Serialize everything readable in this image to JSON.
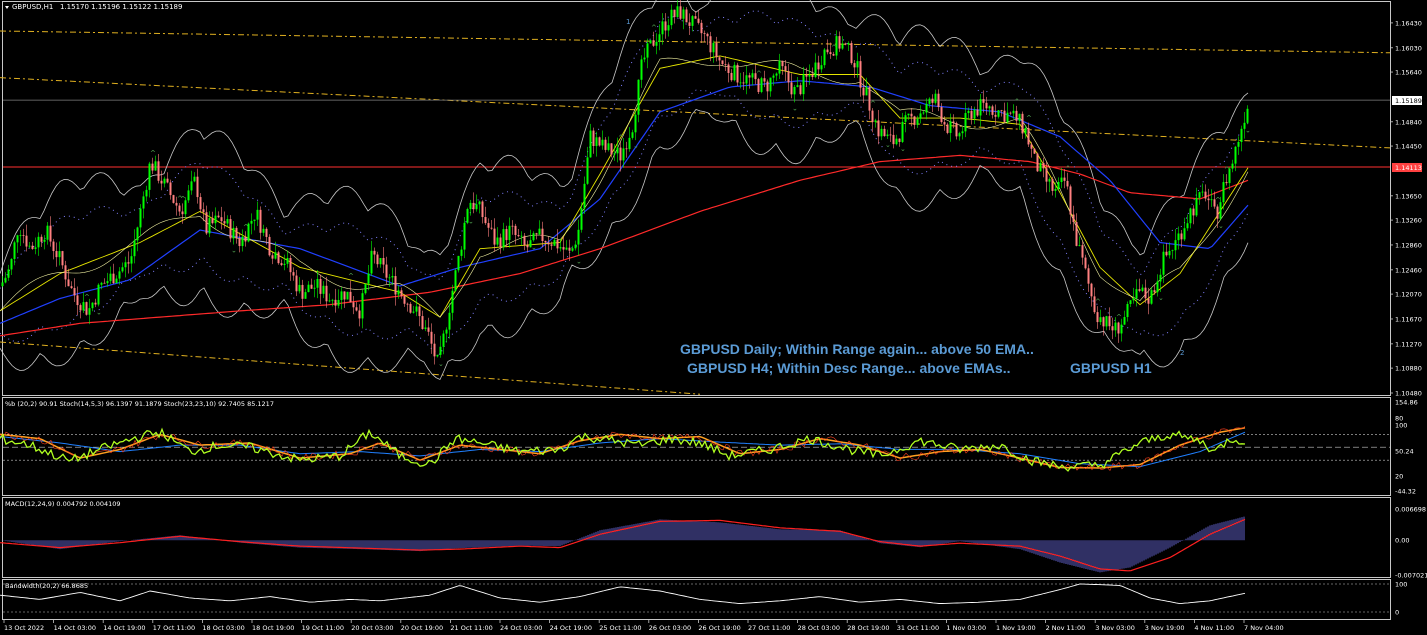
{
  "window": {
    "title": "GBPUSD,H1",
    "ohlc": "1.15170 1.15196 1.15122 1.15189"
  },
  "colors": {
    "background": "#000000",
    "frame": "#c8c8c8",
    "bull": "#00ff00",
    "bear": "#ff8080",
    "ema_red": "#ff2a2a",
    "ema_blue": "#2040ff",
    "ema_yellow": "#e6e600",
    "bands": "#c8c8c8",
    "channel": "#e0b020",
    "annotation": "#5b9bd5",
    "pct_b": "#b0ff20",
    "stoch_slow": "#ffa020",
    "stoch_mid": "#2080ff",
    "macd_hist": "#6060c8",
    "macd_signal": "#ff2020",
    "bandwidth": "#ffffff"
  },
  "main_panel": {
    "price_ticks": [
      "1.16430",
      "1.16030",
      "1.15640",
      "1.14840",
      "1.14450",
      "1.13650",
      "1.13260",
      "1.12860",
      "1.12460",
      "1.12070",
      "1.11670",
      "1.11270",
      "1.10880",
      "1.10480"
    ],
    "current_price_label": "1.15189",
    "level_price_label": "1.14113",
    "wave_labels": [
      "1",
      "2"
    ],
    "annotations": [
      "GBPUSD Daily; Within Range again... above 50 EMA..",
      "GBPUSD H4;  Within Desc Range... above EMAs..",
      "GBPUSD H1"
    ]
  },
  "indicator_panel": {
    "title": "%b (20,2) 90.91  Stoch(14,5,3) 96.1397 91.1879  Stoch(23,23,10) 92.7405 85.1217",
    "ticks": [
      "154.86",
      "80",
      "100",
      "50.24",
      "20",
      "-44.32"
    ]
  },
  "macd_panel": {
    "title": "MACD(12,24,9) 0.004792 0.004109",
    "ticks": [
      "0.006698",
      "0.00",
      "-0.007021"
    ]
  },
  "bandwidth_panel": {
    "title": "Bandwidth(20,2) 66.8685",
    "ticks": [
      "100",
      "0"
    ]
  },
  "time_axis": {
    "labels": [
      "13 Oct 2022",
      "14 Oct 03:00",
      "14 Oct 19:00",
      "17 Oct 11:00",
      "18 Oct 03:00",
      "18 Oct 19:00",
      "19 Oct 11:00",
      "20 Oct 03:00",
      "20 Oct 19:00",
      "21 Oct 11:00",
      "24 Oct 03:00",
      "24 Oct 19:00",
      "25 Oct 11:00",
      "26 Oct 03:00",
      "26 Oct 19:00",
      "27 Oct 11:00",
      "28 Oct 03:00",
      "28 Oct 19:00",
      "31 Oct 11:00",
      "1 Nov 03:00",
      "1 Nov 19:00",
      "2 Nov 11:00",
      "3 Nov 03:00",
      "3 Nov 19:00",
      "4 Nov 11:00",
      "7 Nov 04:00"
    ]
  },
  "chart_data": {
    "type": "candlestick",
    "symbol": "GBPUSD",
    "timeframe": "H1",
    "ylim": [
      1.1048,
      1.1675
    ],
    "close_path": [
      [
        0,
        1.122
      ],
      [
        10,
        1.125
      ],
      [
        18,
        1.132
      ],
      [
        30,
        1.128
      ],
      [
        45,
        1.131
      ],
      [
        60,
        1.126
      ],
      [
        72,
        1.121
      ],
      [
        88,
        1.118
      ],
      [
        100,
        1.122
      ],
      [
        115,
        1.124
      ],
      [
        130,
        1.126
      ],
      [
        150,
        1.142
      ],
      [
        165,
        1.138
      ],
      [
        180,
        1.134
      ],
      [
        195,
        1.139
      ],
      [
        205,
        1.131
      ],
      [
        220,
        1.133
      ],
      [
        240,
        1.129
      ],
      [
        255,
        1.134
      ],
      [
        270,
        1.128
      ],
      [
        285,
        1.126
      ],
      [
        300,
        1.121
      ],
      [
        315,
        1.122
      ],
      [
        330,
        1.12
      ],
      [
        345,
        1.121
      ],
      [
        360,
        1.118
      ],
      [
        372,
        1.127
      ],
      [
        385,
        1.124
      ],
      [
        400,
        1.121
      ],
      [
        415,
        1.118
      ],
      [
        428,
        1.114
      ],
      [
        438,
        1.109
      ],
      [
        448,
        1.118
      ],
      [
        460,
        1.128
      ],
      [
        468,
        1.136
      ],
      [
        480,
        1.134
      ],
      [
        495,
        1.129
      ],
      [
        510,
        1.131
      ],
      [
        525,
        1.128
      ],
      [
        540,
        1.13
      ],
      [
        555,
        1.129
      ],
      [
        570,
        1.127
      ],
      [
        578,
        1.131
      ],
      [
        590,
        1.146
      ],
      [
        605,
        1.144
      ],
      [
        620,
        1.143
      ],
      [
        632,
        1.148
      ],
      [
        642,
        1.158
      ],
      [
        655,
        1.162
      ],
      [
        668,
        1.165
      ],
      [
        680,
        1.166
      ],
      [
        692,
        1.164
      ],
      [
        705,
        1.162
      ],
      [
        720,
        1.158
      ],
      [
        735,
        1.156
      ],
      [
        750,
        1.155
      ],
      [
        765,
        1.154
      ],
      [
        780,
        1.157
      ],
      [
        795,
        1.153
      ],
      [
        810,
        1.156
      ],
      [
        825,
        1.16
      ],
      [
        840,
        1.161
      ],
      [
        852,
        1.159
      ],
      [
        865,
        1.153
      ],
      [
        878,
        1.147
      ],
      [
        892,
        1.145
      ],
      [
        905,
        1.148
      ],
      [
        920,
        1.15
      ],
      [
        935,
        1.152
      ],
      [
        945,
        1.148
      ],
      [
        958,
        1.146
      ],
      [
        970,
        1.15
      ],
      [
        985,
        1.151
      ],
      [
        1000,
        1.15
      ],
      [
        1015,
        1.149
      ],
      [
        1025,
        1.147
      ],
      [
        1034,
        1.142
      ],
      [
        1045,
        1.139
      ],
      [
        1055,
        1.137
      ],
      [
        1065,
        1.139
      ],
      [
        1075,
        1.13
      ],
      [
        1085,
        1.124
      ],
      [
        1095,
        1.118
      ],
      [
        1105,
        1.116
      ],
      [
        1115,
        1.115
      ],
      [
        1125,
        1.117
      ],
      [
        1138,
        1.121
      ],
      [
        1150,
        1.12
      ],
      [
        1162,
        1.126
      ],
      [
        1175,
        1.129
      ],
      [
        1190,
        1.134
      ],
      [
        1205,
        1.137
      ],
      [
        1215,
        1.133
      ],
      [
        1225,
        1.139
      ],
      [
        1232,
        1.142
      ],
      [
        1240,
        1.147
      ],
      [
        1248,
        1.1519
      ]
    ],
    "ema_red_path": [
      [
        0,
        1.114
      ],
      [
        80,
        1.116
      ],
      [
        160,
        1.117
      ],
      [
        240,
        1.118
      ],
      [
        330,
        1.119
      ],
      [
        430,
        1.121
      ],
      [
        520,
        1.124
      ],
      [
        600,
        1.128
      ],
      [
        700,
        1.134
      ],
      [
        800,
        1.139
      ],
      [
        880,
        1.142
      ],
      [
        960,
        1.143
      ],
      [
        1030,
        1.142
      ],
      [
        1080,
        1.14
      ],
      [
        1130,
        1.137
      ],
      [
        1200,
        1.136
      ],
      [
        1248,
        1.139
      ]
    ],
    "ema_blue_path": [
      [
        0,
        1.116
      ],
      [
        60,
        1.12
      ],
      [
        130,
        1.123
      ],
      [
        200,
        1.131
      ],
      [
        300,
        1.128
      ],
      [
        400,
        1.122
      ],
      [
        460,
        1.125
      ],
      [
        540,
        1.128
      ],
      [
        600,
        1.136
      ],
      [
        660,
        1.15
      ],
      [
        730,
        1.154
      ],
      [
        800,
        1.155
      ],
      [
        870,
        1.154
      ],
      [
        930,
        1.151
      ],
      [
        1000,
        1.15
      ],
      [
        1060,
        1.146
      ],
      [
        1110,
        1.139
      ],
      [
        1160,
        1.129
      ],
      [
        1210,
        1.128
      ],
      [
        1248,
        1.135
      ]
    ],
    "ema_yellow_path": [
      [
        0,
        1.118
      ],
      [
        60,
        1.124
      ],
      [
        140,
        1.129
      ],
      [
        200,
        1.134
      ],
      [
        300,
        1.125
      ],
      [
        400,
        1.121
      ],
      [
        440,
        1.117
      ],
      [
        480,
        1.128
      ],
      [
        560,
        1.129
      ],
      [
        600,
        1.14
      ],
      [
        660,
        1.157
      ],
      [
        720,
        1.159
      ],
      [
        800,
        1.156
      ],
      [
        860,
        1.156
      ],
      [
        900,
        1.149
      ],
      [
        960,
        1.149
      ],
      [
        1020,
        1.148
      ],
      [
        1060,
        1.137
      ],
      [
        1100,
        1.125
      ],
      [
        1140,
        1.119
      ],
      [
        1180,
        1.124
      ],
      [
        1220,
        1.134
      ],
      [
        1248,
        1.141
      ]
    ],
    "channel_lines": [
      {
        "from": [
          0,
          1.163
        ],
        "to": [
          1390,
          1.1595
        ]
      },
      {
        "from": [
          0,
          1.1555
        ],
        "to": [
          1390,
          1.1442
        ]
      },
      {
        "from": [
          0,
          1.113
        ],
        "to": [
          700,
          1.1046
        ]
      }
    ],
    "horizontal_levels": [
      1.15189,
      1.14113
    ],
    "indicator_series": {
      "pct_b": [
        [
          0,
          70
        ],
        [
          30,
          55
        ],
        [
          70,
          18
        ],
        [
          100,
          45
        ],
        [
          140,
          75
        ],
        [
          160,
          85
        ],
        [
          190,
          40
        ],
        [
          220,
          55
        ],
        [
          250,
          50
        ],
        [
          300,
          20
        ],
        [
          340,
          30
        ],
        [
          370,
          85
        ],
        [
          400,
          30
        ],
        [
          430,
          10
        ],
        [
          455,
          70
        ],
        [
          480,
          60
        ],
        [
          520,
          40
        ],
        [
          560,
          45
        ],
        [
          580,
          75
        ],
        [
          600,
          70
        ],
        [
          640,
          55
        ],
        [
          670,
          70
        ],
        [
          700,
          60
        ],
        [
          730,
          30
        ],
        [
          770,
          45
        ],
        [
          810,
          70
        ],
        [
          850,
          45
        ],
        [
          880,
          30
        ],
        [
          920,
          65
        ],
        [
          960,
          45
        ],
        [
          1000,
          55
        ],
        [
          1030,
          20
        ],
        [
          1060,
          5
        ],
        [
          1100,
          8
        ],
        [
          1140,
          60
        ],
        [
          1170,
          80
        ],
        [
          1200,
          65
        ],
        [
          1215,
          40
        ],
        [
          1230,
          70
        ],
        [
          1245,
          65
        ]
      ],
      "stoch_slow": [
        [
          0,
          80
        ],
        [
          40,
          70
        ],
        [
          80,
          25
        ],
        [
          120,
          45
        ],
        [
          160,
          80
        ],
        [
          200,
          55
        ],
        [
          250,
          60
        ],
        [
          300,
          25
        ],
        [
          350,
          35
        ],
        [
          380,
          60
        ],
        [
          420,
          20
        ],
        [
          460,
          55
        ],
        [
          500,
          45
        ],
        [
          540,
          35
        ],
        [
          580,
          65
        ],
        [
          620,
          80
        ],
        [
          660,
          70
        ],
        [
          700,
          75
        ],
        [
          740,
          35
        ],
        [
          780,
          45
        ],
        [
          820,
          70
        ],
        [
          860,
          55
        ],
        [
          900,
          25
        ],
        [
          940,
          40
        ],
        [
          980,
          45
        ],
        [
          1020,
          25
        ],
        [
          1060,
          3
        ],
        [
          1100,
          2
        ],
        [
          1140,
          10
        ],
        [
          1180,
          55
        ],
        [
          1220,
          85
        ],
        [
          1245,
          95
        ]
      ],
      "stoch_mid": [
        [
          0,
          75
        ],
        [
          60,
          60
        ],
        [
          120,
          40
        ],
        [
          180,
          55
        ],
        [
          240,
          55
        ],
        [
          300,
          35
        ],
        [
          360,
          40
        ],
        [
          420,
          30
        ],
        [
          480,
          45
        ],
        [
          540,
          40
        ],
        [
          600,
          60
        ],
        [
          660,
          70
        ],
        [
          720,
          62
        ],
        [
          780,
          55
        ],
        [
          840,
          58
        ],
        [
          900,
          45
        ],
        [
          960,
          45
        ],
        [
          1020,
          35
        ],
        [
          1080,
          12
        ],
        [
          1140,
          5
        ],
        [
          1200,
          40
        ],
        [
          1245,
          85
        ]
      ]
    },
    "macd_series": {
      "signal": [
        [
          0,
          -0.0005
        ],
        [
          60,
          -0.0015
        ],
        [
          120,
          -0.0005
        ],
        [
          180,
          0.0008
        ],
        [
          240,
          -0.0003
        ],
        [
          300,
          -0.0012
        ],
        [
          360,
          -0.0016
        ],
        [
          420,
          -0.002
        ],
        [
          460,
          -0.0018
        ],
        [
          520,
          -0.0012
        ],
        [
          560,
          -0.0015
        ],
        [
          600,
          0.0012
        ],
        [
          660,
          0.0038
        ],
        [
          720,
          0.004
        ],
        [
          780,
          0.0025
        ],
        [
          840,
          0.0018
        ],
        [
          880,
          -0.0003
        ],
        [
          920,
          -0.0012
        ],
        [
          960,
          -0.0006
        ],
        [
          1020,
          -0.0012
        ],
        [
          1060,
          -0.0032
        ],
        [
          1100,
          -0.0058
        ],
        [
          1130,
          -0.0062
        ],
        [
          1170,
          -0.0035
        ],
        [
          1210,
          0.0012
        ],
        [
          1245,
          0.0042
        ]
      ],
      "histogram": [
        [
          0,
          0.0
        ],
        [
          60,
          -0.0018
        ],
        [
          120,
          -0.0002
        ],
        [
          180,
          0.001
        ],
        [
          240,
          -0.0005
        ],
        [
          300,
          -0.0015
        ],
        [
          360,
          -0.0018
        ],
        [
          420,
          -0.0022
        ],
        [
          460,
          -0.0016
        ],
        [
          520,
          -0.0011
        ],
        [
          560,
          -0.0012
        ],
        [
          600,
          0.002
        ],
        [
          660,
          0.0042
        ],
        [
          720,
          0.0036
        ],
        [
          780,
          0.0022
        ],
        [
          840,
          0.002
        ],
        [
          880,
          -0.0006
        ],
        [
          920,
          -0.0014
        ],
        [
          960,
          -0.0002
        ],
        [
          1020,
          -0.0018
        ],
        [
          1060,
          -0.0045
        ],
        [
          1100,
          -0.0065
        ],
        [
          1130,
          -0.0055
        ],
        [
          1170,
          -0.0015
        ],
        [
          1210,
          0.003
        ],
        [
          1245,
          0.0048
        ]
      ]
    },
    "bandwidth_series": [
      [
        0,
        60
      ],
      [
        40,
        45
      ],
      [
        80,
        70
      ],
      [
        120,
        40
      ],
      [
        150,
        75
      ],
      [
        190,
        50
      ],
      [
        230,
        40
      ],
      [
        270,
        55
      ],
      [
        310,
        35
      ],
      [
        350,
        45
      ],
      [
        380,
        40
      ],
      [
        430,
        60
      ],
      [
        460,
        95
      ],
      [
        500,
        50
      ],
      [
        540,
        35
      ],
      [
        580,
        55
      ],
      [
        620,
        90
      ],
      [
        660,
        75
      ],
      [
        700,
        45
      ],
      [
        740,
        30
      ],
      [
        780,
        40
      ],
      [
        820,
        55
      ],
      [
        860,
        35
      ],
      [
        900,
        45
      ],
      [
        940,
        30
      ],
      [
        980,
        35
      ],
      [
        1020,
        45
      ],
      [
        1060,
        80
      ],
      [
        1080,
        100
      ],
      [
        1120,
        95
      ],
      [
        1150,
        50
      ],
      [
        1180,
        30
      ],
      [
        1210,
        40
      ],
      [
        1245,
        66.8685
      ]
    ]
  }
}
